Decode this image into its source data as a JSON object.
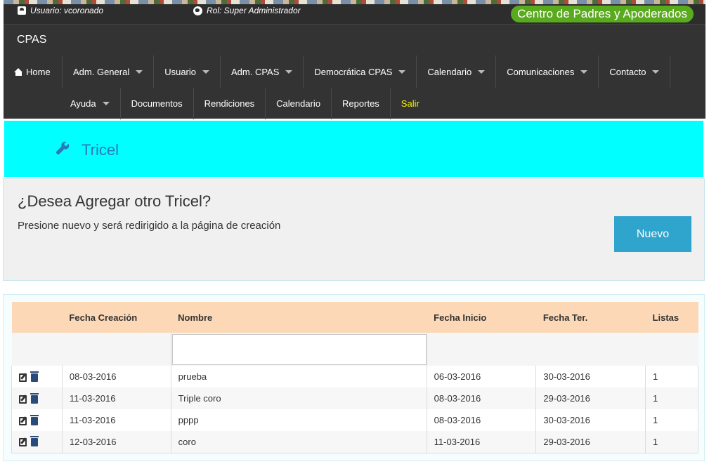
{
  "user": {
    "label": "Usuario: vcoronado",
    "role": "Rol: Super Administrador"
  },
  "org_badge": "Centro de Padres y Apoderados",
  "brand": "CPAS",
  "nav": {
    "home": "Home",
    "row1": [
      {
        "label": "Adm. General",
        "dropdown": true
      },
      {
        "label": "Usuario",
        "dropdown": true
      },
      {
        "label": "Adm. CPAS",
        "dropdown": true
      },
      {
        "label": "Democrática CPAS",
        "dropdown": true
      },
      {
        "label": "Calendario",
        "dropdown": true
      },
      {
        "label": "Comunicaciones",
        "dropdown": true
      },
      {
        "label": "Contacto",
        "dropdown": true
      }
    ],
    "row2": [
      {
        "label": "Ayuda",
        "dropdown": true
      },
      {
        "label": "Documentos",
        "dropdown": false
      },
      {
        "label": "Rendiciones",
        "dropdown": false
      },
      {
        "label": "Calendario",
        "dropdown": false
      },
      {
        "label": "Reportes",
        "dropdown": false
      },
      {
        "label": "Salir",
        "dropdown": false
      }
    ]
  },
  "page_title": "Tricel",
  "panel": {
    "heading": "¿Desea Agregar otro Tricel?",
    "description": "Presione nuevo y será redirigido a la página de creación",
    "button": "Nuevo"
  },
  "table": {
    "headers": [
      "",
      "Fecha Creación",
      "Nombre",
      "Fecha Inicio",
      "Fecha Ter.",
      "Listas"
    ],
    "filter_value": "",
    "rows": [
      {
        "creacion": "08-03-2016",
        "nombre": "prueba",
        "inicio": "06-03-2016",
        "termino": "30-03-2016",
        "listas": "1"
      },
      {
        "creacion": "11-03-2016",
        "nombre": "Triple coro",
        "inicio": "08-03-2016",
        "termino": "29-03-2016",
        "listas": "1"
      },
      {
        "creacion": "11-03-2016",
        "nombre": "pppp",
        "inicio": "08-03-2016",
        "termino": "30-03-2016",
        "listas": "1"
      },
      {
        "creacion": "12-03-2016",
        "nombre": "coro",
        "inicio": "11-03-2016",
        "termino": "29-03-2016",
        "listas": "1"
      }
    ]
  },
  "colors": {
    "accent_cyan": "#00ffff",
    "nav_bg": "#333333",
    "badge_green": "#5aaa1e",
    "button_blue": "#2fa4cc",
    "table_header": "#fcd8b6",
    "logout_yellow": "#f4f000"
  },
  "icons": [
    "user-icon",
    "globe-icon",
    "home-icon",
    "wrench-icon",
    "edit-icon",
    "trash-icon",
    "caret-down-icon"
  ]
}
